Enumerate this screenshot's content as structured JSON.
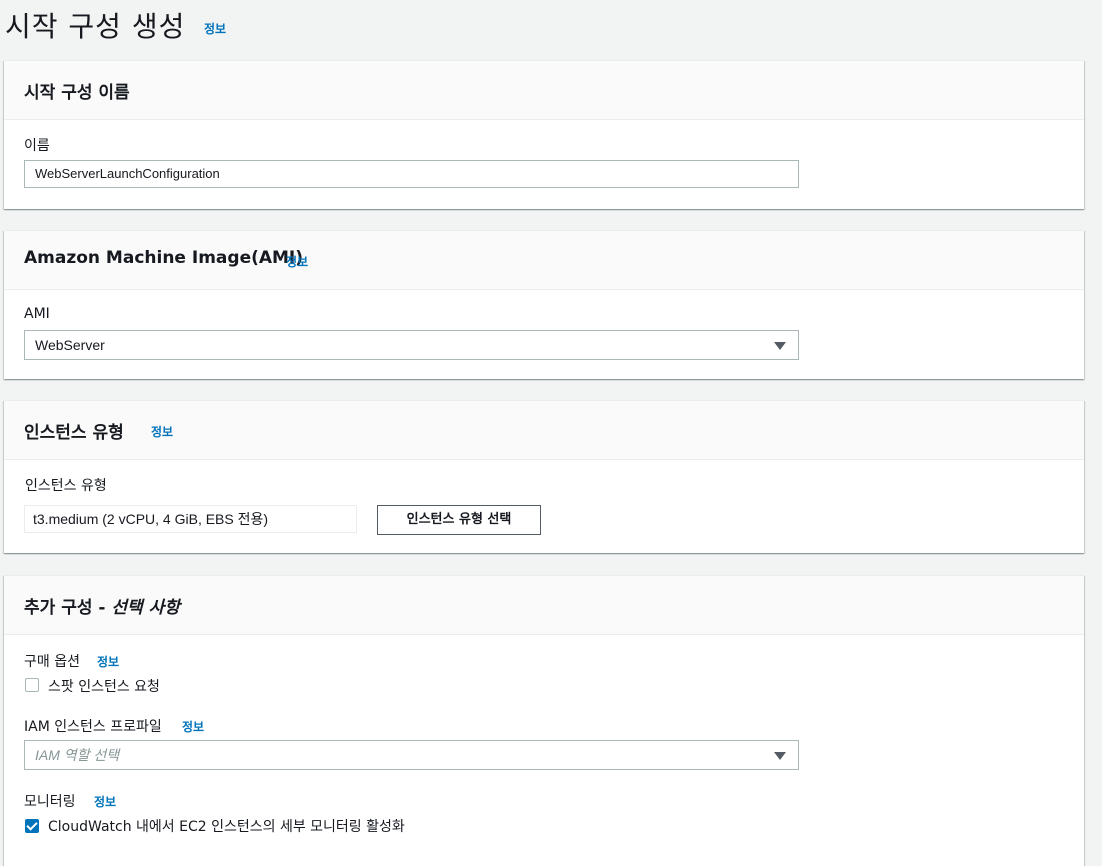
{
  "page": {
    "title": "시작 구성 생성",
    "info": "정보"
  },
  "name_section": {
    "title": "시작 구성 이름",
    "name_label": "이름",
    "name_value": "WebServerLaunchConfiguration"
  },
  "ami_section": {
    "title": "Amazon Machine Image(AMI)",
    "info": "정보",
    "ami_label": "AMI",
    "ami_value": "WebServer"
  },
  "instance_section": {
    "title": "인스턴스 유형",
    "info": "정보",
    "type_label": "인스턴스 유형",
    "type_value": "t3.medium (2 vCPU, 4 GiB, EBS 전용)",
    "choose_button": "인스턴스 유형 선택"
  },
  "additional_section": {
    "title_main": "추가 구성 - ",
    "title_italic": "선택 사항",
    "purchase_label": "구매 옵션",
    "purchase_info": "정보",
    "spot_label": "스팟 인스턴스 요청",
    "spot_checked": false,
    "iam_label": "IAM 인스턴스 프로파일",
    "iam_info": "정보",
    "iam_placeholder": "IAM 역할 선택",
    "monitoring_label": "모니터링",
    "monitoring_info": "정보",
    "monitoring_check_label": "CloudWatch 내에서 EC2 인스턴스의 세부 모니터링 활성화",
    "monitoring_checked": true
  },
  "icons": {
    "dropdown": "chevron-down-icon",
    "check": "check-icon"
  },
  "colors": {
    "link": "#0073bb",
    "checkbox_checked": "#0073bb",
    "background": "#f2f3f3"
  }
}
